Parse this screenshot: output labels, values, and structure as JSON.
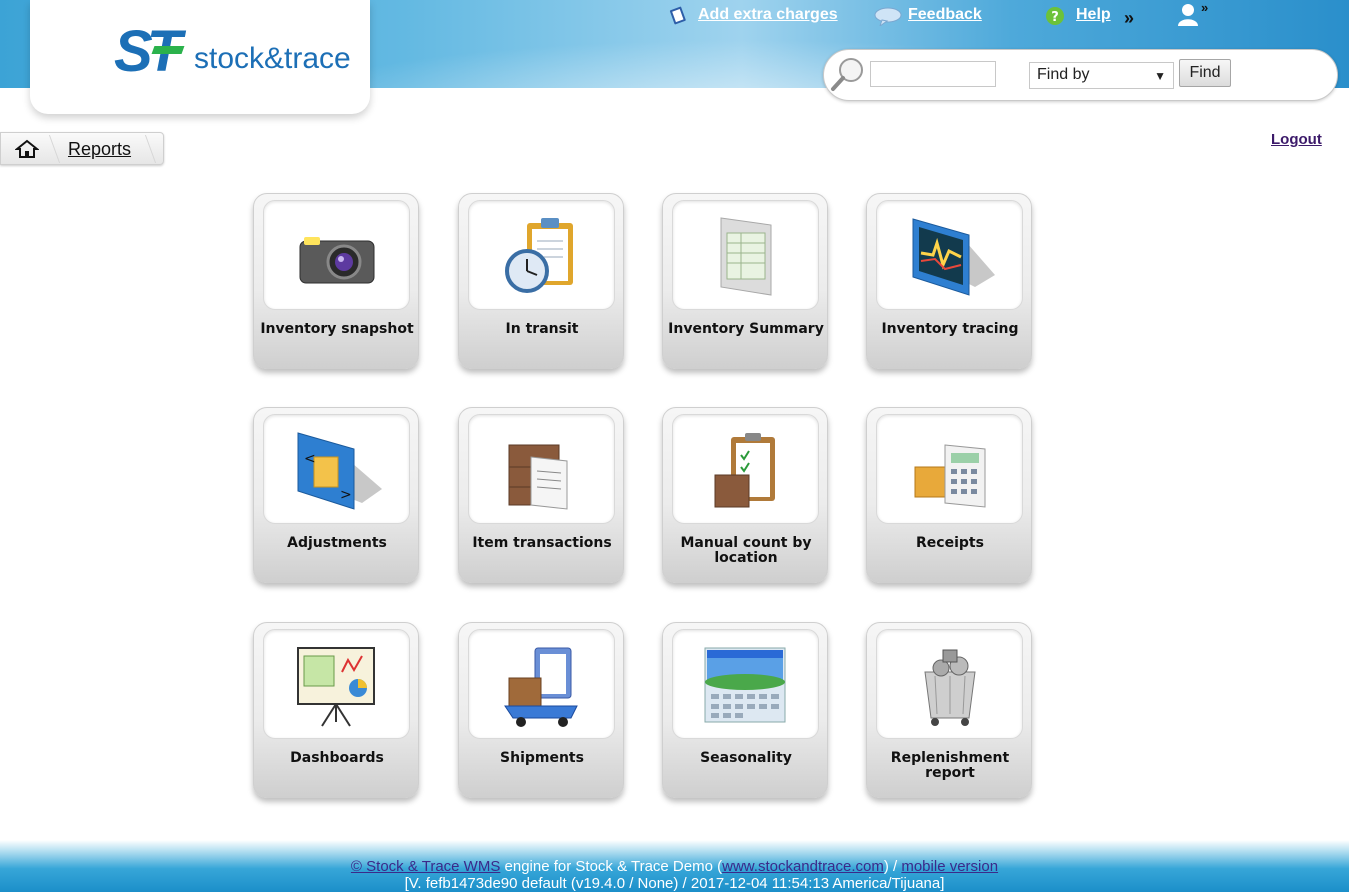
{
  "header": {
    "logo_text": "stock&trace",
    "logo_mark": "ST",
    "links": {
      "extra_charges": "Add extra charges",
      "feedback": "Feedback",
      "help": "Help",
      "more": "»",
      "user_more": "»"
    },
    "search": {
      "input_value": "",
      "find_by": "Find by",
      "find_button": "Find"
    }
  },
  "breadcrumb": {
    "current": "Reports"
  },
  "logout": "Logout",
  "tiles": [
    {
      "label": "Inventory snapshot",
      "icon": "camera-icon"
    },
    {
      "label": "In transit",
      "icon": "clipboard-clock-icon"
    },
    {
      "label": "Inventory Summary",
      "icon": "spreadsheet-icon"
    },
    {
      "label": "Inventory tracing",
      "icon": "monitor-chart-icon"
    },
    {
      "label": "Adjustments",
      "icon": "folder-arrows-icon"
    },
    {
      "label": "Item transactions",
      "icon": "boxes-invoice-icon"
    },
    {
      "label": "Manual count by location",
      "icon": "clipboard-boxes-icon"
    },
    {
      "label": "Receipts",
      "icon": "box-calculator-icon"
    },
    {
      "label": "Dashboards",
      "icon": "presentation-board-icon"
    },
    {
      "label": "Shipments",
      "icon": "delivery-cart-icon"
    },
    {
      "label": "Seasonality",
      "icon": "calendar-landscape-icon"
    },
    {
      "label": "Replenishment report",
      "icon": "stock-bin-icon"
    }
  ],
  "footer": {
    "copyright_link": "© Stock & Trace WMS",
    "engine_text": " engine for Stock & Trace Demo (",
    "site_link": "www.stockandtrace.com",
    "sep_text": ") / ",
    "mobile_link": "mobile version",
    "version": "[V. fefb1473de90 default (v19.4.0 / None) / 2017-12-04 11:54:13 America/Tijuana]"
  },
  "colors": {
    "brand_blue": "#1c6fb6",
    "brand_green": "#2bb24c",
    "header_blue": "#3ca3d6",
    "link_purple": "#3c1a6a"
  }
}
